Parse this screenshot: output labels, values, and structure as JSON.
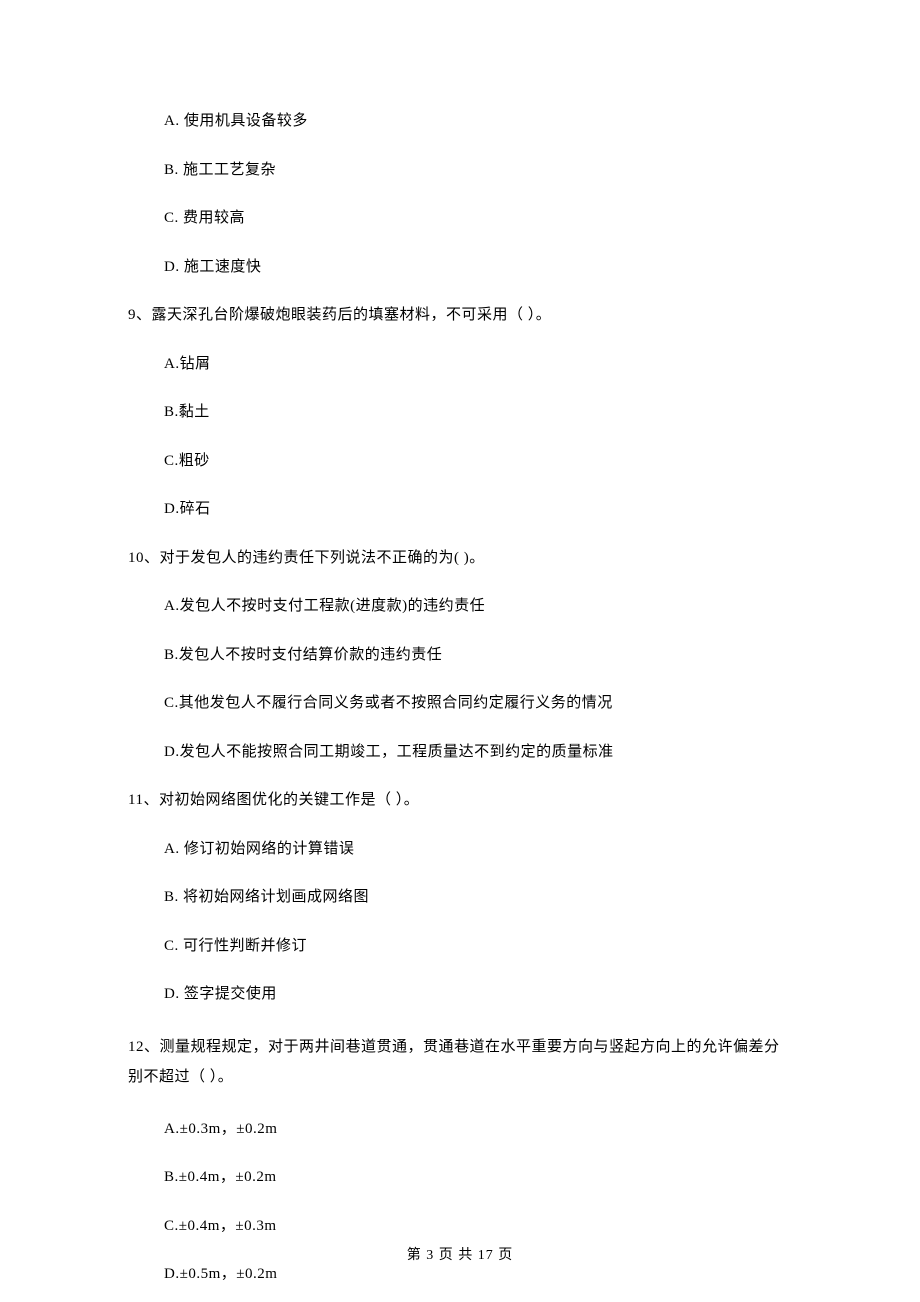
{
  "q8": {
    "options": {
      "a": "A.  使用机具设备较多",
      "b": "B.  施工工艺复杂",
      "c": "C.  费用较高",
      "d": "D.  施工速度快"
    }
  },
  "q9": {
    "stem": "9、露天深孔台阶爆破炮眼装药后的填塞材料，不可采用（    ）。",
    "options": {
      "a": "A.钻屑",
      "b": "B.黏土",
      "c": "C.粗砂",
      "d": "D.碎石"
    }
  },
  "q10": {
    "stem": "10、对于发包人的违约责任下列说法不正确的为(    )。",
    "options": {
      "a": "A.发包人不按时支付工程款(进度款)的违约责任",
      "b": "B.发包人不按时支付结算价款的违约责任",
      "c": "C.其他发包人不履行合同义务或者不按照合同约定履行义务的情况",
      "d": "D.发包人不能按照合同工期竣工，工程质量达不到约定的质量标准"
    }
  },
  "q11": {
    "stem": "11、对初始网络图优化的关键工作是（    ）。",
    "options": {
      "a": "A.  修订初始网络的计算错误",
      "b": "B.  将初始网络计划画成网络图",
      "c": "C.  可行性判断并修订",
      "d": "D.  签字提交使用"
    }
  },
  "q12": {
    "stem": "12、测量规程规定，对于两井间巷道贯通，贯通巷道在水平重要方向与竖起方向上的允许偏差分别不超过（    ）。",
    "options": {
      "a": "A.±0.3m，±0.2m",
      "b": "B.±0.4m，±0.2m",
      "c": "C.±0.4m，±0.3m",
      "d": "D.±0.5m，±0.2m"
    }
  },
  "footer": "第 3 页 共 17 页"
}
